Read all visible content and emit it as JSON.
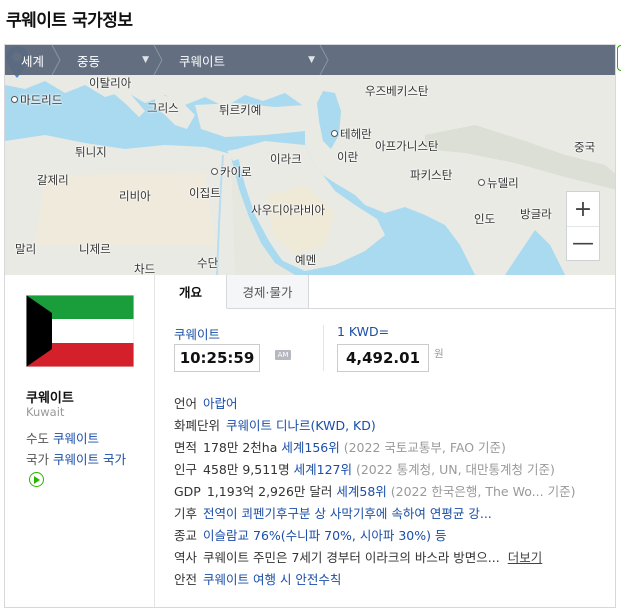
{
  "page": {
    "title": "쿠웨이트 국가정보"
  },
  "breadcrumb": {
    "items": [
      {
        "label": "세계",
        "dropdown": false
      },
      {
        "label": "중동",
        "dropdown": true
      },
      {
        "label": "쿠웨이트",
        "dropdown": true
      }
    ]
  },
  "map": {
    "labels": {
      "italy": "이탈리아",
      "madrid": "마드리드",
      "greece": "그리스",
      "turkey": "튀르키예",
      "uzbekistan": "우즈베키스탄",
      "tehran": "테헤란",
      "tunisia": "튀니지",
      "afghanistan": "아프가니스탄",
      "china": "중국",
      "iraq": "이라크",
      "iran": "이란",
      "cairo": "카이로",
      "algeria": "갈제리",
      "pakistan": "파키스탄",
      "newdelhi": "뉴델리",
      "libya": "리비아",
      "egypt": "이집트",
      "saudi": "사우디아라비아",
      "india": "인도",
      "bangladesh": "방글라",
      "mali": "말리",
      "niger": "니제르",
      "chad": "차드",
      "sudan": "수단",
      "yemen": "예멘"
    },
    "zoom_in": "+",
    "zoom_out": "—",
    "pin_icon": "location-pin-icon"
  },
  "country": {
    "name": "쿠웨이트",
    "name_en": "Kuwait",
    "capital_label": "수도",
    "capital": "쿠웨이트",
    "anthem_label": "국가",
    "anthem": "쿠웨이트 국가",
    "anthem_icon": "play-icon"
  },
  "tabs": [
    {
      "label": "개요",
      "active": true
    },
    {
      "label": "경제·물가",
      "active": false
    }
  ],
  "clock": {
    "label": "쿠웨이트",
    "time": "10:25:59",
    "ampm": "AM"
  },
  "exchange": {
    "label": "1 KWD=",
    "value": "4,492.01",
    "unit": "원"
  },
  "info": {
    "language": {
      "key": "언어",
      "value": "아랍어"
    },
    "currency": {
      "key": "화폐단위",
      "value": "쿠웨이트 디나르(KWD, KD)"
    },
    "area": {
      "key": "면적",
      "value": "178만 2천ha",
      "rank": "세계156위",
      "note": "(2022 국토교통부, FAO 기준)"
    },
    "population": {
      "key": "인구",
      "value": "458만 9,511명",
      "rank": "세계127위",
      "note": "(2022 통계청, UN, 대만통계청 기준)"
    },
    "gdp": {
      "key": "GDP",
      "value": "1,193억 2,926만 달러",
      "rank": "세계58위",
      "note": "(2022 한국은행, The Wo...",
      "note_tail": "기준)"
    },
    "climate": {
      "key": "기후",
      "value": "전역이 쾨펜기후구분 상 사막기후에 속하여 연평균 강..."
    },
    "religion": {
      "key": "종교",
      "value": "이슬람교 76%(수니파 70%, 시아파 30%) 등"
    },
    "history": {
      "key": "역사",
      "value": "쿠웨이트 주민은 7세기 경부터 이라크의 바스라 방면으...",
      "more": "더보기"
    },
    "safety": {
      "key": "안전",
      "value": "쿠웨이트 여행 시 안전수칙"
    }
  },
  "colors": {
    "link": "#1a4ea8",
    "breadcrumb_bg": "#5c687a",
    "accent_green": "#2db400",
    "sea": "#aadaf0",
    "land": "#e9eae4"
  }
}
